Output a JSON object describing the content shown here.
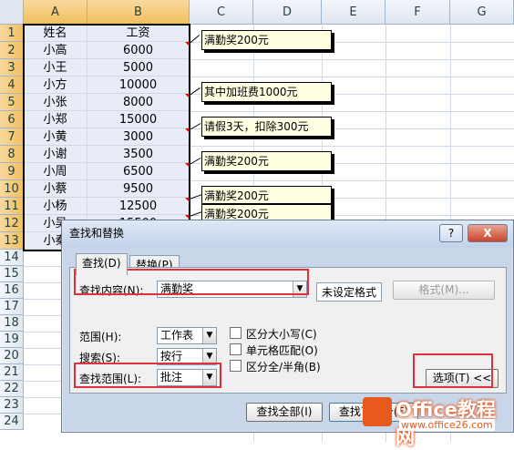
{
  "columns": [
    "A",
    "B",
    "C",
    "D",
    "E",
    "F",
    "G"
  ],
  "rows": [
    "1",
    "2",
    "3",
    "4",
    "5",
    "6",
    "7",
    "8",
    "9",
    "10",
    "11",
    "12",
    "13",
    "14",
    "15",
    "16",
    "17",
    "18",
    "19",
    "20",
    "21",
    "22",
    "23",
    "24"
  ],
  "cells": {
    "a": [
      "姓名",
      "小高",
      "小王",
      "小方",
      "小张",
      "小郑",
      "小黄",
      "小谢",
      "小周",
      "小蔡",
      "小杨",
      "小吴",
      "小秦"
    ],
    "b": [
      "工资",
      "6000",
      "5000",
      "10000",
      "8000",
      "15000",
      "3000",
      "3500",
      "6500",
      "9500",
      "12500",
      "15500",
      ""
    ]
  },
  "comments": [
    "满勤奖200元",
    "其中加班费1000元",
    "请假3天，扣除300元",
    "满勤奖200元",
    "满勤奖200元",
    "满勤奖200元"
  ],
  "dialog": {
    "title": "查找和替换",
    "help": "?",
    "close": "X",
    "tab_find": "查找(D)",
    "tab_replace": "替换(P)",
    "find_label": "查找内容(N):",
    "find_value": "满勤奖",
    "format_status": "未设定格式",
    "format_button": "格式(M)...",
    "scope_label": "范围(H):",
    "scope_value": "工作表",
    "search_label": "搜索(S):",
    "search_value": "按行",
    "lookin_label": "查找范围(L):",
    "lookin_value": "批注",
    "match_case": "区分大小写(C)",
    "match_cell": "单元格匹配(O)",
    "match_width": "区分全/半角(B)",
    "options_button": "选项(T) <<",
    "find_all_button": "查找全部(I)",
    "find_next_button": "查找下一个(F)"
  },
  "watermark": {
    "brand": "Office教程网",
    "url": "www.office26.com"
  }
}
